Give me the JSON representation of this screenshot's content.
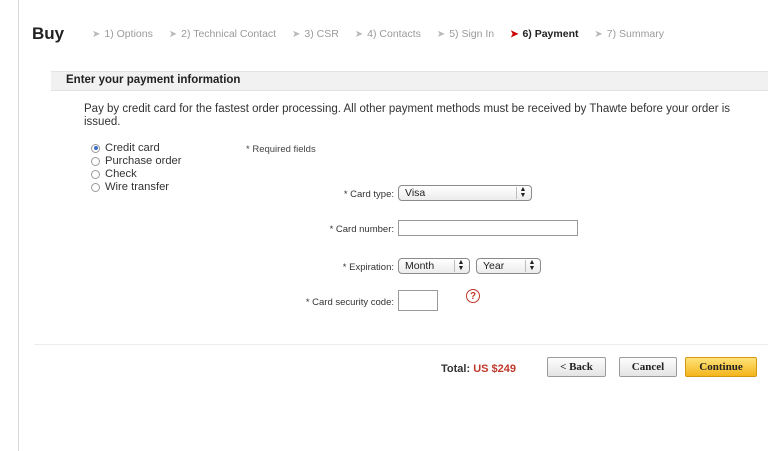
{
  "header": {
    "title": "Buy",
    "steps": [
      {
        "label": "1) Options"
      },
      {
        "label": "2) Technical Contact"
      },
      {
        "label": "3) CSR"
      },
      {
        "label": "4) Contacts"
      },
      {
        "label": "5) Sign In"
      },
      {
        "label": "6) Payment"
      },
      {
        "label": "7) Summary"
      }
    ],
    "active_step": 6
  },
  "panel": {
    "title": "Enter your payment information",
    "intro": "Pay by credit card for the fastest order processing. All other payment methods must be received by Thawte before your order is issued."
  },
  "payment_methods": {
    "options": [
      "Credit card",
      "Purchase order",
      "Check",
      "Wire transfer"
    ],
    "selected": "Credit card"
  },
  "form": {
    "required_note": "* Required fields",
    "card_type_label": "* Card type:",
    "card_type_value": "Visa",
    "card_number_label": "* Card number:",
    "card_number_value": "",
    "expiration_label": "* Expiration:",
    "month_value": "Month",
    "year_value": "Year",
    "security_code_label": "* Card security code:",
    "security_code_value": "",
    "help_glyph": "?"
  },
  "footer": {
    "total_label": "Total:",
    "total_amount": "US $249",
    "back_label": "< Back",
    "cancel_label": "Cancel",
    "continue_label": "Continue"
  },
  "colors": {
    "accent_red": "#c0392b",
    "continue_button": "#f4b51c",
    "radio_selected": "#3a6fc9"
  },
  "icons": {
    "step_arrow": "arrow-right-icon",
    "help": "question-circle-icon",
    "select": "chevron-updown-icon"
  }
}
